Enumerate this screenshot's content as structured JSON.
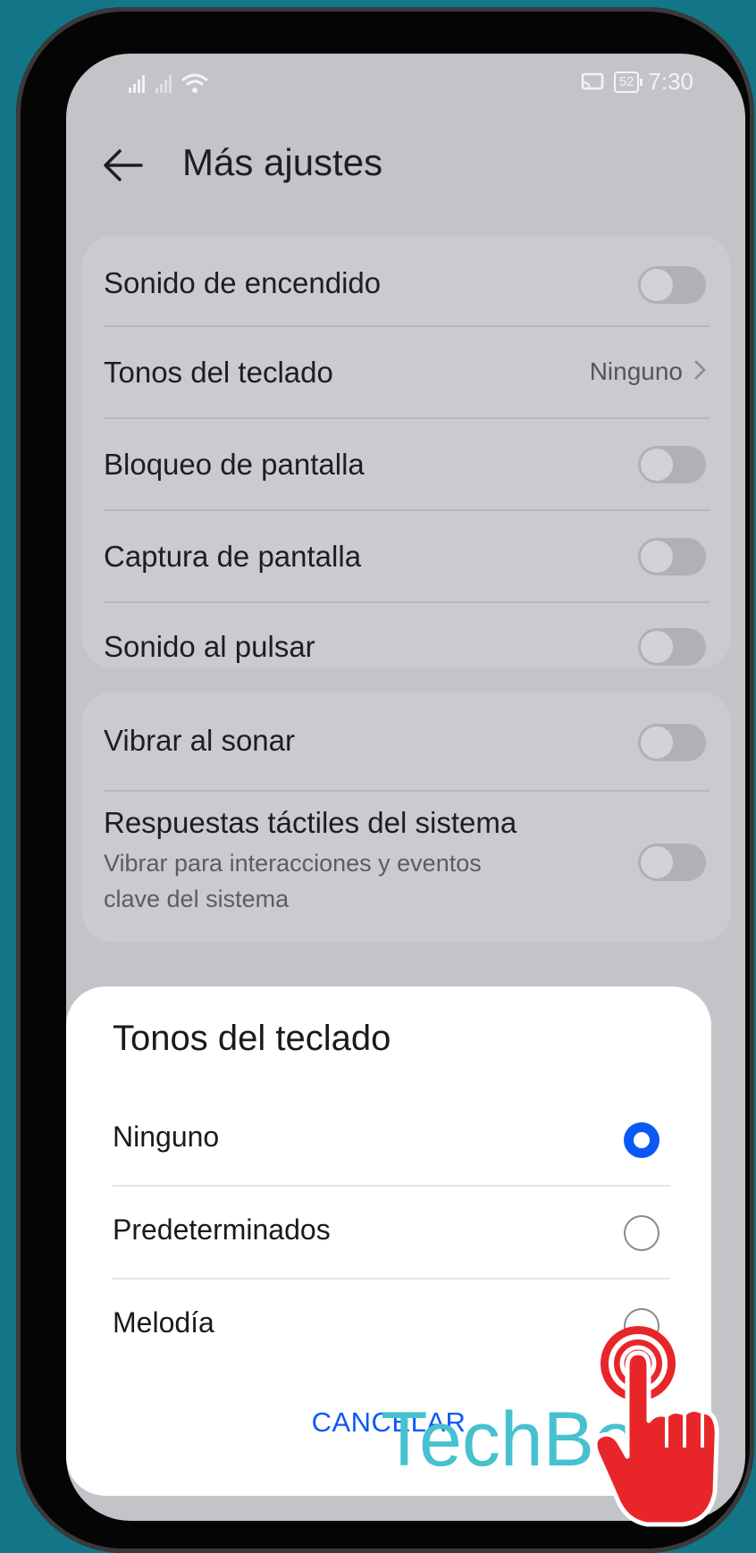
{
  "status_bar": {
    "signal_text": "📶 📶 ",
    "wifi": "wifi-icon",
    "battery": "52",
    "time": "7:30"
  },
  "header": {
    "title": "Más ajustes"
  },
  "settings_group1": [
    {
      "label": "Sonido de encendido",
      "type": "toggle",
      "on": false
    },
    {
      "label": "Tonos del teclado",
      "type": "value",
      "value": "Ninguno"
    },
    {
      "label": "Bloqueo de pantalla",
      "type": "toggle",
      "on": false
    },
    {
      "label": "Captura de pantalla",
      "type": "toggle",
      "on": false
    },
    {
      "label": "Sonido al pulsar",
      "type": "toggle",
      "on": false
    }
  ],
  "settings_group2": {
    "vibrar": {
      "label": "Vibrar al sonar",
      "on": false
    },
    "respuestas": {
      "label": "Respuestas táctiles del sistema",
      "sub1": "Vibrar para interacciones y eventos",
      "sub2": "clave del sistema",
      "on": false
    }
  },
  "dialog": {
    "title": "Tonos del teclado",
    "options": [
      {
        "label": "Ninguno",
        "selected": true
      },
      {
        "label": "Predeterminados",
        "selected": false
      },
      {
        "label": "Melodía",
        "selected": false
      }
    ],
    "cancel_label": "CANCELAR"
  },
  "watermark": "TechBo",
  "colors": {
    "accent": "#0a59f7",
    "background": "#137688",
    "watermark": "#47c1cf",
    "hand": "#e8262a"
  }
}
